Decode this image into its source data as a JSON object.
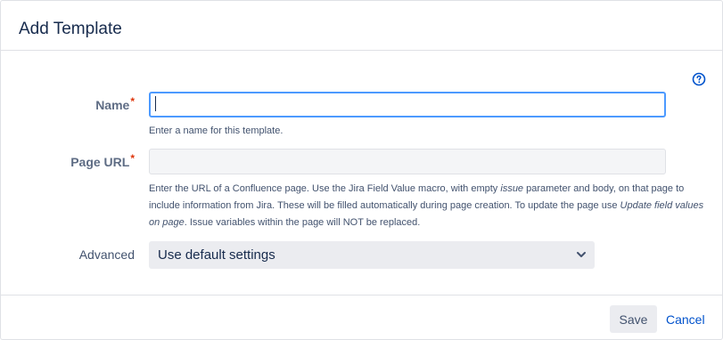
{
  "dialog": {
    "title": "Add Template"
  },
  "help_icon": "question-circle-icon",
  "fields": {
    "name": {
      "label": "Name",
      "required_marker": "*",
      "value": "",
      "placeholder": "",
      "help": "Enter a name for this template."
    },
    "page_url": {
      "label": "Page URL",
      "required_marker": "*",
      "value": "",
      "placeholder": "",
      "help": {
        "part1": "Enter the URL of a Confluence page. Use the Jira Field Value macro, with empty ",
        "issue_word": "issue",
        "part2": " parameter and body, on that page to include information from Jira. These will be filled automatically during page creation. To update the page use ",
        "update_phrase": "Update field values on page",
        "part3": ". Issue variables within the page will NOT be replaced."
      }
    },
    "advanced": {
      "label": "Advanced",
      "selected": "Use default settings"
    }
  },
  "footer": {
    "save_label": "Save",
    "cancel_label": "Cancel"
  },
  "colors": {
    "focus_border": "#4c9aff",
    "required": "#de350b",
    "link": "#0052cc",
    "help_icon": "#0052cc"
  }
}
